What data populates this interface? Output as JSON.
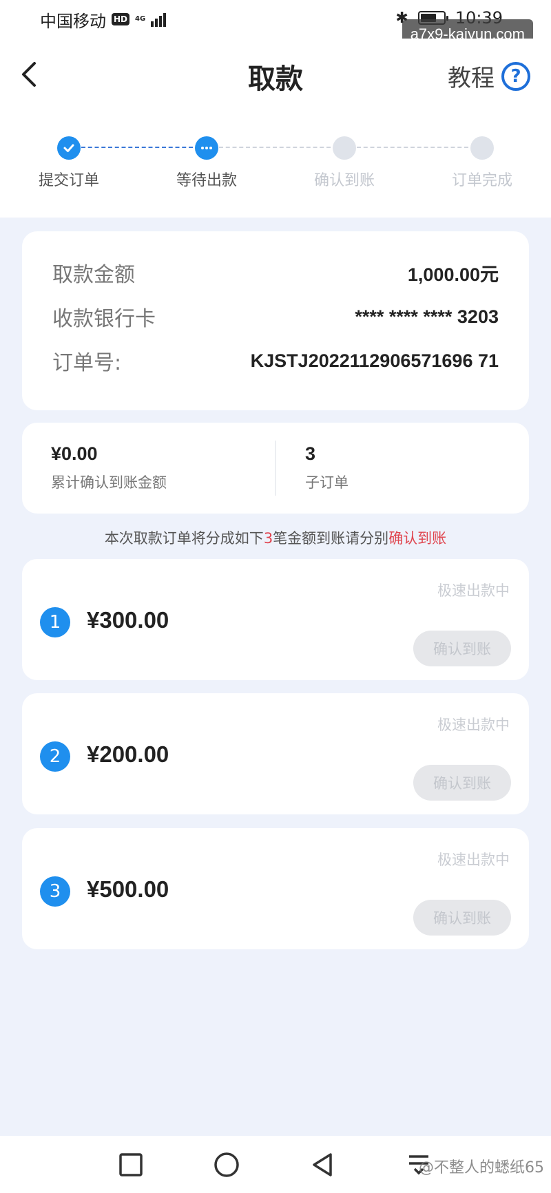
{
  "status_bar": {
    "carrier": "中国移动",
    "hd": "HD",
    "network": "4G",
    "time": "10:39"
  },
  "watermark_top": "a7x9-kaiyun.com",
  "header": {
    "title": "取款",
    "tutorial_label": "教程",
    "help_glyph": "?"
  },
  "progress": {
    "steps": [
      {
        "label": "提交订单",
        "state": "done"
      },
      {
        "label": "等待出款",
        "state": "current"
      },
      {
        "label": "确认到账",
        "state": "pending"
      },
      {
        "label": "订单完成",
        "state": "pending"
      }
    ]
  },
  "info": {
    "amount_label": "取款金额",
    "amount_value": "1,000.00元",
    "card_label": "收款银行卡",
    "card_value": "**** **** **** 3203",
    "order_label": "订单号:",
    "order_value": "KJSTJ2022112906571696 71"
  },
  "summary": {
    "confirmed_amount": "¥0.00",
    "confirmed_label": "累计确认到账金额",
    "sub_count": "3",
    "sub_label": "子订单"
  },
  "notice": {
    "prefix": "本次取款订单将分成如下",
    "count": "3",
    "middle": "笔金额到账请分别",
    "highlight": "确认到账"
  },
  "sub_orders": [
    {
      "index": "1",
      "amount": "¥300.00",
      "status": "极速出款中",
      "button": "确认到账"
    },
    {
      "index": "2",
      "amount": "¥200.00",
      "status": "极速出款中",
      "button": "确认到账"
    },
    {
      "index": "3",
      "amount": "¥500.00",
      "status": "极速出款中",
      "button": "确认到账"
    }
  ],
  "watermark_bottom": "@不整人的蟋纸65",
  "colors": {
    "accent": "#1f8fee",
    "highlight": "#e0454f",
    "background": "#eef2fb"
  }
}
